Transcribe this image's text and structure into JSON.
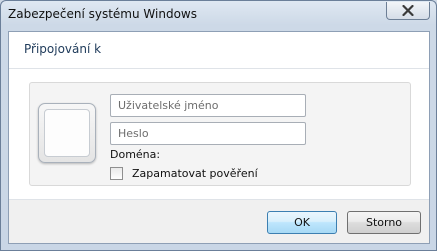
{
  "window": {
    "title": "Zabezpečení systému Windows",
    "close_icon": "close-icon"
  },
  "dialog": {
    "heading": "Připojování k",
    "username_placeholder": "Uživatelské jméno",
    "password_placeholder": "Heslo",
    "domain_label": "Doména:",
    "remember_label": "Zapamatovat pověření",
    "remember_checked": false,
    "user_tile_icon": "user-tile-icon"
  },
  "buttons": {
    "ok_label": "OK",
    "cancel_label": "Storno"
  },
  "colors": {
    "heading": "#1e3a5a",
    "ok_button_border": "#3c7fb1"
  }
}
